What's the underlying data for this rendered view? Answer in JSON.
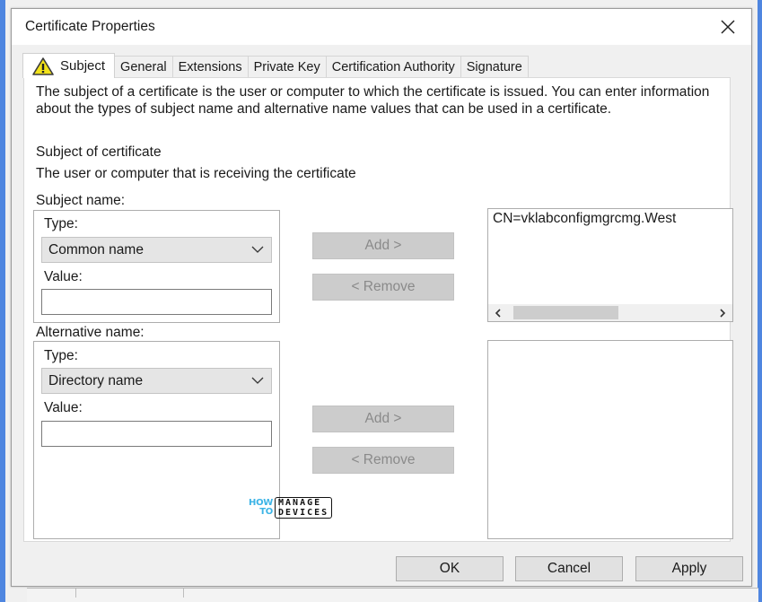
{
  "window": {
    "title": "Certificate Properties",
    "close_icon": "close-icon"
  },
  "tabs": [
    {
      "label": "Subject",
      "active": true,
      "icon": "warning-icon"
    },
    {
      "label": "General",
      "active": false
    },
    {
      "label": "Extensions",
      "active": false
    },
    {
      "label": "Private Key",
      "active": false
    },
    {
      "label": "Certification Authority",
      "active": false
    },
    {
      "label": "Signature",
      "active": false
    }
  ],
  "subject_tab": {
    "description": "The subject of a certificate is the user or computer to which the certificate is issued. You can enter information about the types of subject name and alternative name values that can be used in a certificate.",
    "section_title": "Subject of certificate",
    "section_subtitle": "The user or computer that is receiving the certificate",
    "subject_name": {
      "label": "Subject name:",
      "type_label": "Type:",
      "type_selected": "Common name",
      "value_label": "Value:",
      "value": "",
      "add_button": "Add >",
      "remove_button": "< Remove",
      "list_entries": [
        "CN=vklabconfigmgrcmg.West"
      ],
      "scroll_left_icon": "chevron-left-icon",
      "scroll_right_icon": "chevron-right-icon"
    },
    "alternative_name": {
      "label": "Alternative name:",
      "type_label": "Type:",
      "type_selected": "Directory name",
      "value_label": "Value:",
      "value": "",
      "add_button": "Add >",
      "remove_button": "< Remove",
      "list_entries": []
    }
  },
  "footer": {
    "ok": "OK",
    "cancel": "Cancel",
    "apply": "Apply"
  },
  "watermark": {
    "left_top": "HOW",
    "left_bottom": "TO",
    "box_top": "MANAGE",
    "box_bottom": "DEVICES"
  },
  "colors": {
    "frame_border": "#4f86e0",
    "watermark_accent": "#3cb4e6",
    "warning_icon": "#f2e21a"
  }
}
